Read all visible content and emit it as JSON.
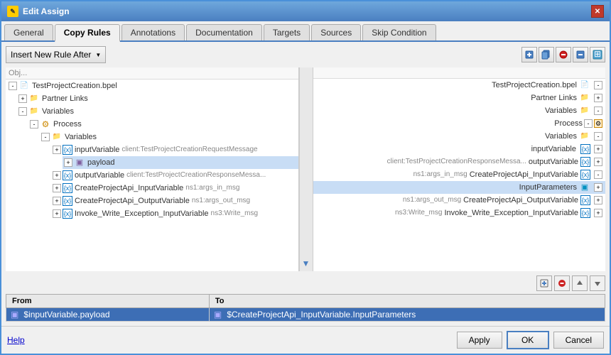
{
  "window": {
    "title": "Edit Assign",
    "title_icon": "✎",
    "close_label": "✕"
  },
  "tabs": [
    {
      "label": "General",
      "active": false
    },
    {
      "label": "Copy Rules",
      "active": true
    },
    {
      "label": "Annotations",
      "active": false
    },
    {
      "label": "Documentation",
      "active": false
    },
    {
      "label": "Targets",
      "active": false
    },
    {
      "label": "Sources",
      "active": false
    },
    {
      "label": "Skip Condition",
      "active": false
    }
  ],
  "toolbar": {
    "insert_btn_label": "Insert New Rule After",
    "icons": [
      "⊕",
      "✦",
      "✕",
      "⊟",
      "◈"
    ]
  },
  "left_panel": {
    "header": "Obj...",
    "tree": [
      {
        "id": "bpel",
        "indent": 0,
        "expand": "-",
        "icon": "📄",
        "icon_class": "icon-bpel",
        "label": "TestProjectCreation.bpel"
      },
      {
        "id": "partner",
        "indent": 1,
        "expand": "+",
        "icon": "📁",
        "icon_class": "icon-folder",
        "label": "Partner Links"
      },
      {
        "id": "variables",
        "indent": 1,
        "expand": "-",
        "icon": "📁",
        "icon_class": "icon-folder",
        "label": "Variables"
      },
      {
        "id": "process",
        "indent": 2,
        "expand": "-",
        "icon": "⚙",
        "icon_class": "icon-proc",
        "label": "Process"
      },
      {
        "id": "proc-vars",
        "indent": 3,
        "expand": "-",
        "icon": "📁",
        "icon_class": "icon-folder",
        "label": "Variables"
      },
      {
        "id": "inputVar",
        "indent": 4,
        "expand": "+",
        "icon": "{x}",
        "icon_class": "icon-var",
        "label": "inputVariable",
        "extra": "client:TestProjectCreationRequestMessage"
      },
      {
        "id": "payload",
        "indent": 5,
        "expand": "+",
        "icon": "▣",
        "icon_class": "icon-payload",
        "label": "payload",
        "highlighted": true
      },
      {
        "id": "outputVar",
        "indent": 4,
        "expand": "+",
        "icon": "{x}",
        "icon_class": "icon-var",
        "label": "outputVariable",
        "extra": "client:TestProjectCreationResponseMessa..."
      },
      {
        "id": "createApiIn",
        "indent": 4,
        "expand": "+",
        "icon": "{x}",
        "icon_class": "icon-var",
        "label": "CreateProjectApi_InputVariable",
        "extra": "ns1:args_in_msg"
      },
      {
        "id": "createApiOut",
        "indent": 4,
        "expand": "+",
        "icon": "{x}",
        "icon_class": "icon-var",
        "label": "CreateProjectApi_OutputVariable",
        "extra": "ns1:args_out_msg"
      },
      {
        "id": "invokeWrite",
        "indent": 4,
        "expand": "+",
        "icon": "{x}",
        "icon_class": "icon-var",
        "label": "Invoke_Write_Exception_InputVariable",
        "extra": "ns3:Write_msg"
      }
    ]
  },
  "right_panel": {
    "header": "",
    "tree": [
      {
        "id": "bpel-r",
        "indent": 0,
        "expand": "-",
        "icon": "📄",
        "icon_class": "icon-bpel",
        "label": "TestProjectCreation.bpel"
      },
      {
        "id": "partner-r",
        "indent": 1,
        "expand": "+",
        "icon": "📁",
        "icon_class": "icon-folder",
        "label": "Partner Links"
      },
      {
        "id": "variables-r",
        "indent": 1,
        "expand": "-",
        "icon": "📁",
        "icon_class": "icon-folder",
        "label": "Variables"
      },
      {
        "id": "process-r",
        "indent": 2,
        "expand": "-",
        "icon": "⚙",
        "icon_class": "icon-proc",
        "label": "Process"
      },
      {
        "id": "proc-vars-r",
        "indent": 3,
        "expand": "-",
        "icon": "📁",
        "icon_class": "icon-folder",
        "label": "Variables"
      },
      {
        "id": "inputVar-r",
        "indent": 4,
        "expand": "+",
        "icon": "{x}",
        "icon_class": "icon-var",
        "label": "inputVariable",
        "extra": "client:TestProjectCreationRequestMessage"
      },
      {
        "id": "outputVar-r",
        "indent": 4,
        "expand": "+",
        "icon": "{x}",
        "icon_class": "icon-var",
        "label": "outputVariable",
        "extra": "client:TestProjectCreationResponseMessa..."
      },
      {
        "id": "createApiIn-r",
        "indent": 4,
        "expand": "-",
        "icon": "{x}",
        "icon_class": "icon-var",
        "label": "CreateProjectApi_InputVariable",
        "extra": "ns1:args_in_msg"
      },
      {
        "id": "inputParams",
        "indent": 5,
        "expand": "+",
        "icon": "▣",
        "icon_class": "icon-param",
        "label": "InputParameters",
        "highlighted": true
      },
      {
        "id": "createApiOut-r",
        "indent": 4,
        "expand": "+",
        "icon": "{x}",
        "icon_class": "icon-var",
        "label": "CreateProjectApi_OutputVariable",
        "extra": "ns1:args_out_msg"
      },
      {
        "id": "invokeWrite-r",
        "indent": 4,
        "expand": "+",
        "icon": "{x}",
        "icon_class": "icon-var",
        "label": "Invoke_Write_Exception_InputVariable",
        "extra": "ns3:Write_msg"
      }
    ]
  },
  "action_icons": [
    "➕",
    "✕",
    "▲",
    "▼"
  ],
  "mapping_table": {
    "columns": [
      "From",
      "To"
    ],
    "rows": [
      {
        "selected": true,
        "from_icon": "▣",
        "from_label": "$inputVariable.payload",
        "to_icon": "▣",
        "to_label": "$CreateProjectApi_InputVariable.InputParameters"
      }
    ]
  },
  "footer": {
    "help_label": "Help",
    "apply_label": "Apply",
    "ok_label": "OK",
    "cancel_label": "Cancel"
  }
}
